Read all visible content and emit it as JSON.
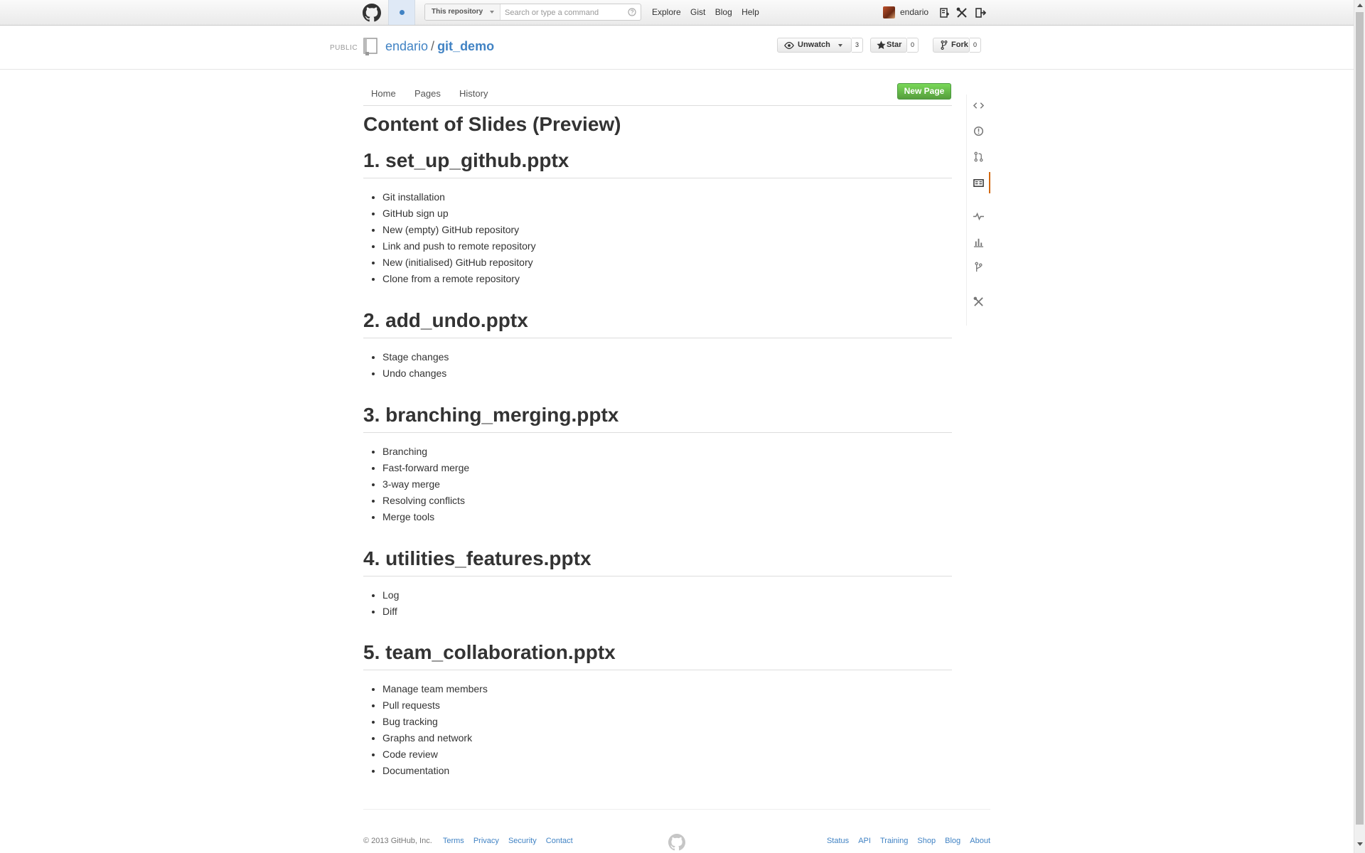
{
  "header": {
    "search_scope": "This repository",
    "search_placeholder": "Search or type a command",
    "nav": [
      "Explore",
      "Gist",
      "Blog",
      "Help"
    ],
    "username": "endario",
    "icons": [
      "github-octocat-icon",
      "notification-icon",
      "help-icon",
      "new-repo-icon",
      "settings-tools-icon",
      "sign-out-icon"
    ]
  },
  "repo": {
    "visibility": "PUBLIC",
    "owner": "endario",
    "separator": "/",
    "name": "git_demo",
    "unwatch_label": "Unwatch",
    "watch_count": "3",
    "star_label": "Star",
    "star_count": "0",
    "fork_label": "Fork",
    "fork_count": "0"
  },
  "wiki": {
    "tabs": [
      "Home",
      "Pages",
      "History"
    ],
    "new_page_label": "New Page",
    "title": "Content of Slides (Preview)",
    "sections": [
      {
        "heading": "1. set_up_github.pptx",
        "items": [
          "Git installation",
          "GitHub sign up",
          "New (empty) GitHub repository",
          "Link and push to remote repository",
          "New (initialised) GitHub repository",
          "Clone from a remote repository"
        ]
      },
      {
        "heading": "2. add_undo.pptx",
        "items": [
          "Stage changes",
          "Undo changes"
        ]
      },
      {
        "heading": "3. branching_merging.pptx",
        "items": [
          "Branching",
          "Fast-forward merge",
          "3-way merge",
          "Resolving conflicts",
          "Merge tools"
        ]
      },
      {
        "heading": "4. utilities_features.pptx",
        "items": [
          "Log",
          "Diff"
        ]
      },
      {
        "heading": "5. team_collaboration.pptx",
        "items": [
          "Manage team members",
          "Pull requests",
          "Bug tracking",
          "Graphs and network",
          "Code review",
          "Documentation"
        ]
      }
    ]
  },
  "sidebar": {
    "icons": [
      "code-icon",
      "issues-icon",
      "pull-request-icon",
      "wiki-icon",
      "pulse-icon",
      "graphs-icon",
      "network-icon",
      "settings-icon"
    ],
    "active": "wiki-icon",
    "accent_color": "#d26911"
  },
  "footer": {
    "copyright": "© 2013 GitHub, Inc.",
    "left_links": [
      "Terms",
      "Privacy",
      "Security",
      "Contact"
    ],
    "right_links": [
      "Status",
      "API",
      "Training",
      "Shop",
      "Blog",
      "About"
    ]
  },
  "colors": {
    "link": "#4183c4",
    "new_page_button": "#6cc644",
    "text": "#333333"
  }
}
